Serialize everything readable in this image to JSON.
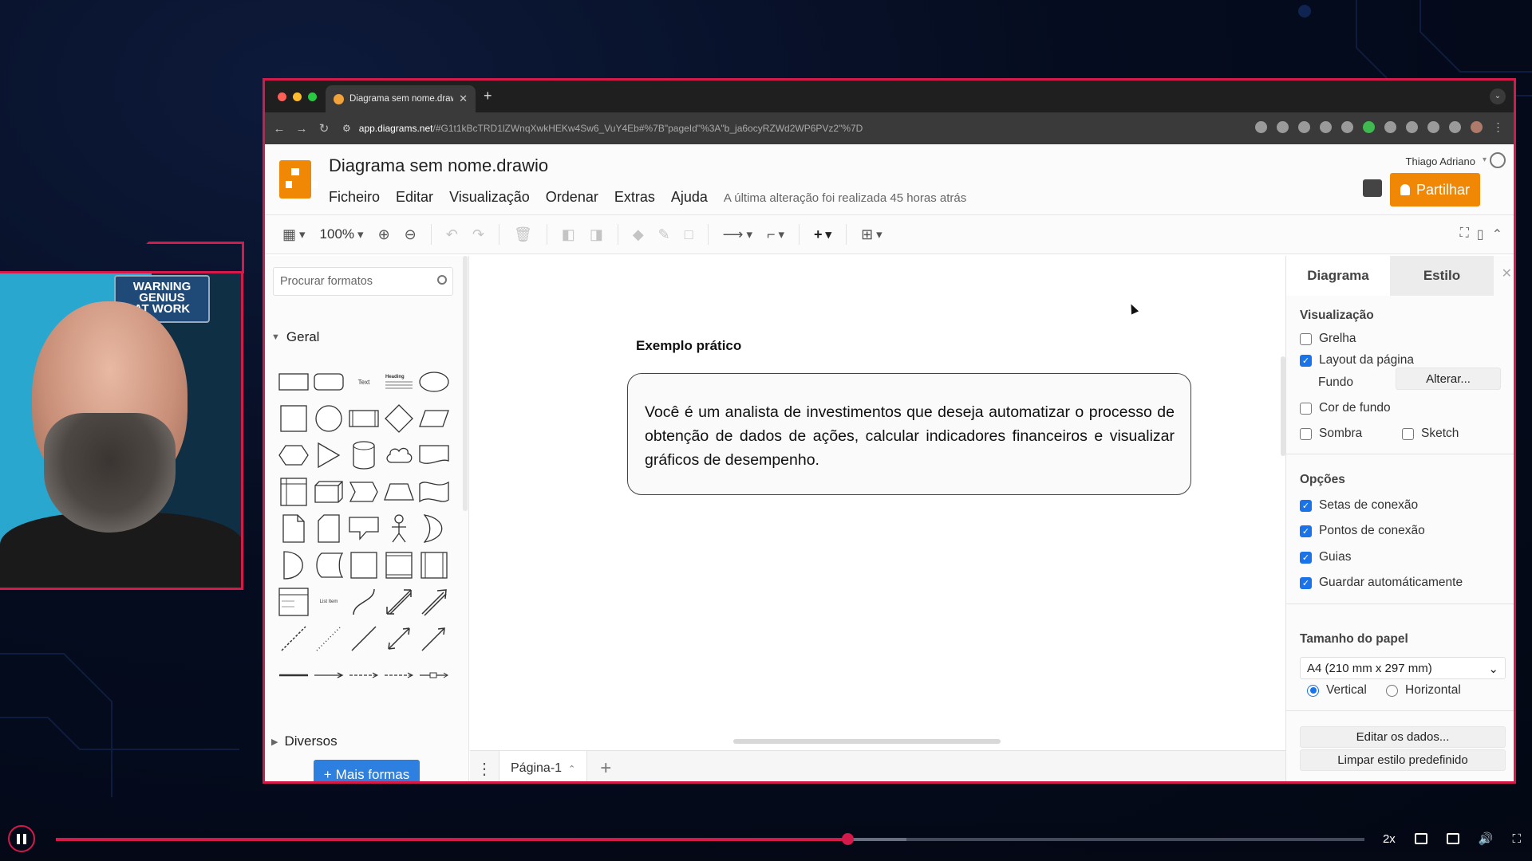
{
  "webcam": {
    "warning_sign": "WARNING\nGENIUS\nAT WORK"
  },
  "browser": {
    "tab_title": "Diagrama sem nome.drawio",
    "url_host": "app.diagrams.net",
    "url_rest": "/#G1t1kBcTRD1lZWnqXwkHEKw4Sw6_VuY4Eb#%7B\"pageId\"%3A\"b_ja6ocyRZWd2WP6PVz2\"%7D"
  },
  "app": {
    "doc_title": "Diagrama sem nome.drawio",
    "menu": [
      "Ficheiro",
      "Editar",
      "Visualização",
      "Ordenar",
      "Extras",
      "Ajuda"
    ],
    "last_edit": "A última alteração foi realizada 45 horas atrás",
    "user_name": "Thiago Adriano",
    "share_label": "Partilhar",
    "zoom": "100%"
  },
  "left_panel": {
    "search_placeholder": "Procurar formatos",
    "section_geral": "Geral",
    "section_diversos": "Diversos",
    "more_shapes": "Mais formas",
    "shape_text_label": "Text",
    "shape_heading_label": "Heading",
    "shape_list_item_label": "List Item"
  },
  "canvas": {
    "example_title": "Exemplo prático",
    "example_text": "Você é um analista de investimentos que deseja automatizar o processo de obtenção de dados de ações, calcular indicadores financeiros e visualizar gráficos de desempenho."
  },
  "page_bar": {
    "page_name": "Página-1"
  },
  "right_panel": {
    "tab_diagram": "Diagrama",
    "tab_style": "Estilo",
    "visualizacao": "Visualização",
    "grid": "Grelha",
    "page_layout": "Layout da página",
    "background": "Fundo",
    "change_button": "Alterar...",
    "background_color": "Cor de fundo",
    "shadow": "Sombra",
    "sketch": "Sketch",
    "options": "Opções",
    "connection_arrows": "Setas de conexão",
    "connection_points": "Pontos de conexão",
    "guides": "Guias",
    "autosave": "Guardar automáticamente",
    "paper_size": "Tamanho do papel",
    "paper_size_value": "A4 (210 mm x 297 mm)",
    "vertical": "Vertical",
    "horizontal": "Horizontal",
    "edit_data": "Editar os dados...",
    "clear_style": "Limpar estilo predefinido"
  },
  "checkboxes": {
    "grid": false,
    "page_layout": true,
    "background_color": false,
    "shadow": false,
    "sketch": false,
    "connection_arrows": true,
    "connection_points": true,
    "guides": true,
    "autosave": true
  },
  "video": {
    "speed": "2x",
    "progress": 0.605,
    "buffered": 0.65
  },
  "colors": {
    "frame_accent": "#d41a4a",
    "drawio_orange": "#f08705",
    "primary_blue": "#2d7fe0"
  }
}
